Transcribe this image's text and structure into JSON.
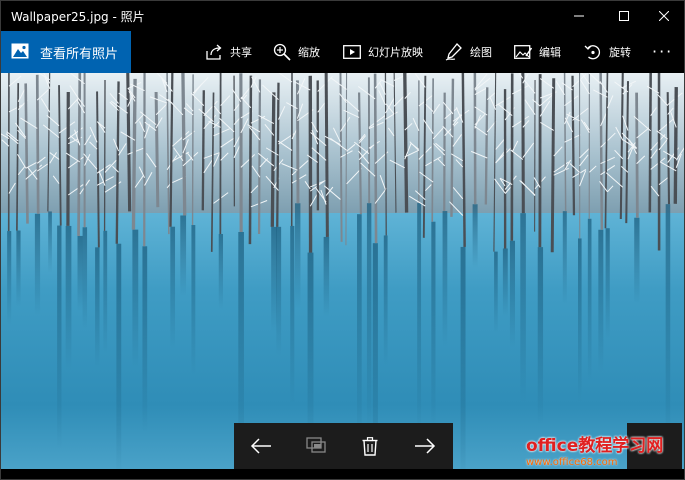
{
  "window": {
    "title": "Wallpaper25.jpg - 照片"
  },
  "commandbar": {
    "all_photos": {
      "label": "查看所有照片",
      "icon": "image-icon"
    },
    "share": {
      "label": "共享",
      "icon": "share-icon"
    },
    "zoom": {
      "label": "缩放",
      "icon": "zoom-in-icon"
    },
    "slideshow": {
      "label": "幻灯片放映",
      "icon": "slideshow-icon"
    },
    "draw": {
      "label": "绘图",
      "icon": "pen-icon"
    },
    "edit": {
      "label": "编辑",
      "icon": "edit-image-icon"
    },
    "rotate": {
      "label": "旋转",
      "icon": "rotate-icon"
    },
    "more": {
      "label": "···",
      "icon": "more-icon"
    }
  },
  "navbar": {
    "prev_icon": "arrow-left-icon",
    "compare_icon": "compare-icon",
    "delete_icon": "trash-icon",
    "next_icon": "arrow-right-icon"
  },
  "watermark": {
    "title": "office教程学习网",
    "url": "www.office68.com"
  },
  "colors": {
    "accent": "#0063b1",
    "chrome": "#000000",
    "navbar": "#1c1c1c",
    "water": "#3f9cc4",
    "watermark_title": "#e02020",
    "watermark_url": "#ff6a00"
  }
}
